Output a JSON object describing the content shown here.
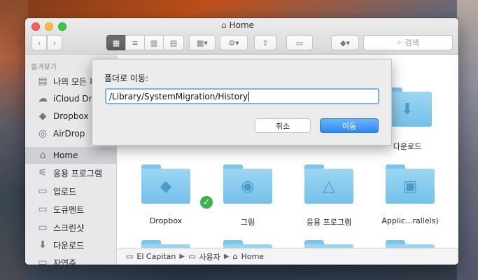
{
  "window": {
    "title": "Home"
  },
  "search": {
    "placeholder": "검색"
  },
  "sidebar": {
    "header": "즐겨찾기",
    "items": [
      {
        "label": "나의 모든 파일",
        "icon": "all-files-icon"
      },
      {
        "label": "iCloud Drive",
        "icon": "cloud-icon"
      },
      {
        "label": "Dropbox",
        "icon": "dropbox-icon"
      },
      {
        "label": "AirDrop",
        "icon": "airdrop-icon"
      },
      {
        "label": "Home",
        "icon": "home-icon",
        "selected": true
      },
      {
        "label": "응용 프로그램",
        "icon": "applications-icon"
      },
      {
        "label": "업로드",
        "icon": "folder-icon"
      },
      {
        "label": "도큐멘트",
        "icon": "folder-icon"
      },
      {
        "label": "스크린샷",
        "icon": "folder-icon"
      },
      {
        "label": "다운로드",
        "icon": "download-icon"
      },
      {
        "label": "자연주",
        "icon": "folder-icon"
      }
    ]
  },
  "content": {
    "folders": [
      {
        "label": "다운로드"
      },
      {
        "label": "Dropbox"
      },
      {
        "label": "그림"
      },
      {
        "label": "응용 프로그램"
      },
      {
        "label": "Applic...rallels)"
      }
    ]
  },
  "pathbar": {
    "items": [
      "El Capitan",
      "사용자",
      "Home"
    ]
  },
  "sheet": {
    "label": "폴더로 이동:",
    "input_value": "/Library/SystemMigration/History",
    "cancel_label": "취소",
    "go_label": "이동"
  }
}
